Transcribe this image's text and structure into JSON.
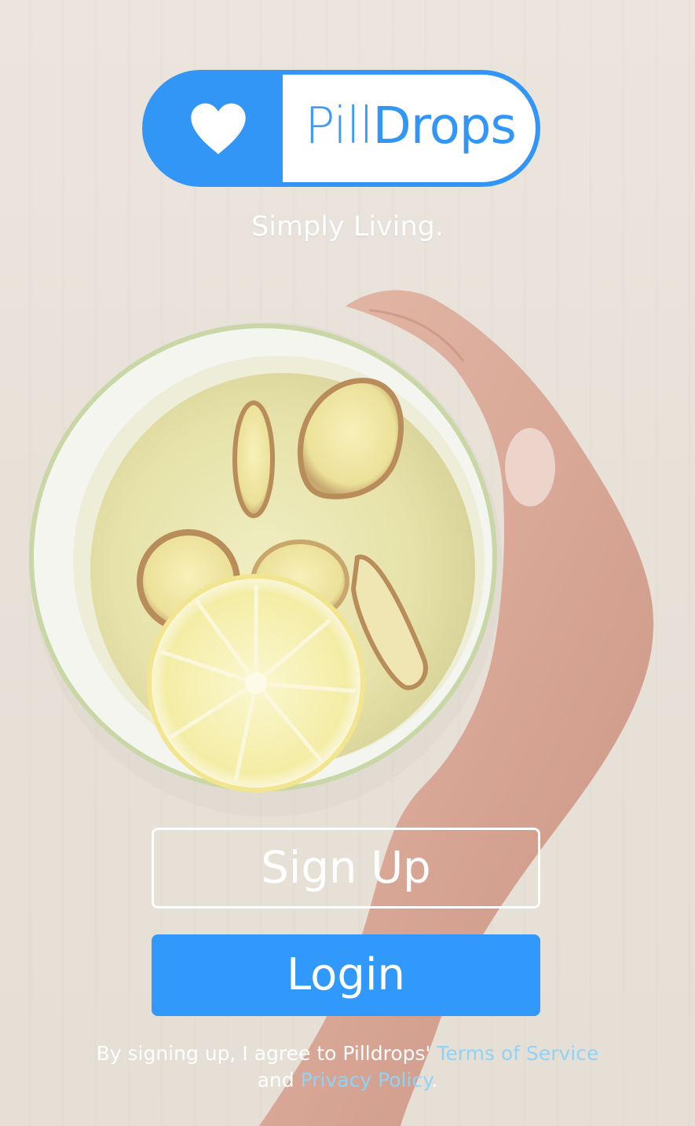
{
  "logo": {
    "text_light": "Pill",
    "text_bold": "Drops",
    "icon": "heart-icon"
  },
  "tagline": "Simply Living.",
  "background_image": "bowl-of-ginger-lemon-tea-held-by-hand",
  "buttons": {
    "signup_label": "Sign Up",
    "login_label": "Login"
  },
  "legal": {
    "prefix": "By signing up, I agree to Pilldrops'",
    "terms_link": "Terms of Service",
    "and_word": "and",
    "privacy_link": "Privacy Policy",
    "suffix": "."
  },
  "colors": {
    "brand_blue": "#3196f6",
    "login_blue": "#3199fb",
    "link_blue": "#8fd3f7",
    "text_white": "#ffffff"
  }
}
